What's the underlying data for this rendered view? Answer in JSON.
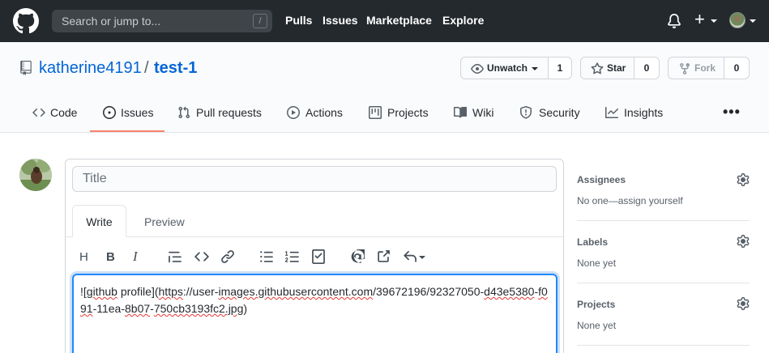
{
  "header": {
    "search_placeholder": "Search or jump to...",
    "search_shortcut": "/",
    "nav": [
      "Pulls",
      "Issues",
      "Marketplace",
      "Explore"
    ],
    "plus_symbol": "+"
  },
  "repo": {
    "owner": "katherine4191",
    "separator": "/",
    "name": "test-1",
    "watch": {
      "label": "Unwatch",
      "count": "1"
    },
    "star": {
      "label": "Star",
      "count": "0"
    },
    "fork": {
      "label": "Fork",
      "count": "0"
    }
  },
  "tabs": [
    {
      "label": "Code",
      "icon": "code-icon"
    },
    {
      "label": "Issues",
      "icon": "issue-icon",
      "selected": true
    },
    {
      "label": "Pull requests",
      "icon": "pull-request-icon"
    },
    {
      "label": "Actions",
      "icon": "play-icon"
    },
    {
      "label": "Projects",
      "icon": "project-icon"
    },
    {
      "label": "Wiki",
      "icon": "book-icon"
    },
    {
      "label": "Security",
      "icon": "shield-icon"
    },
    {
      "label": "Insights",
      "icon": "graph-icon"
    }
  ],
  "more_label": "•••",
  "issue_form": {
    "title_placeholder": "Title",
    "write_tab": "Write",
    "preview_tab": "Preview",
    "toolbar": [
      "heading-icon",
      "bold-icon",
      "italic-icon",
      "quote-icon",
      "code-icon",
      "link-icon",
      "unordered-list-icon",
      "ordered-list-icon",
      "task-list-icon",
      "mention-icon",
      "reference-icon",
      "reply-icon"
    ],
    "body_parts": {
      "p1": "!",
      "p2": "[github",
      "p3": " profile](",
      "p4": "https",
      "p5": "://user-",
      "p6": "images.githubusercontent.com",
      "p7": "/39672196/92327050-",
      "p8": "d43e5380",
      "p9": "-",
      "p10": "f091",
      "p11": "-11ea-",
      "p12": "8b07",
      "p13": "-",
      "p14": "750cb3193fc2.jpg",
      "p15": ")"
    }
  },
  "sidebar": {
    "assignees": {
      "title": "Assignees",
      "value": "No one—assign yourself"
    },
    "labels": {
      "title": "Labels",
      "value": "None yet"
    },
    "projects": {
      "title": "Projects",
      "value": "None yet"
    }
  },
  "colors": {
    "header_bg": "#24292e",
    "link": "#0366d6",
    "tab_underline": "#f9826c",
    "focus": "#2188ff"
  }
}
